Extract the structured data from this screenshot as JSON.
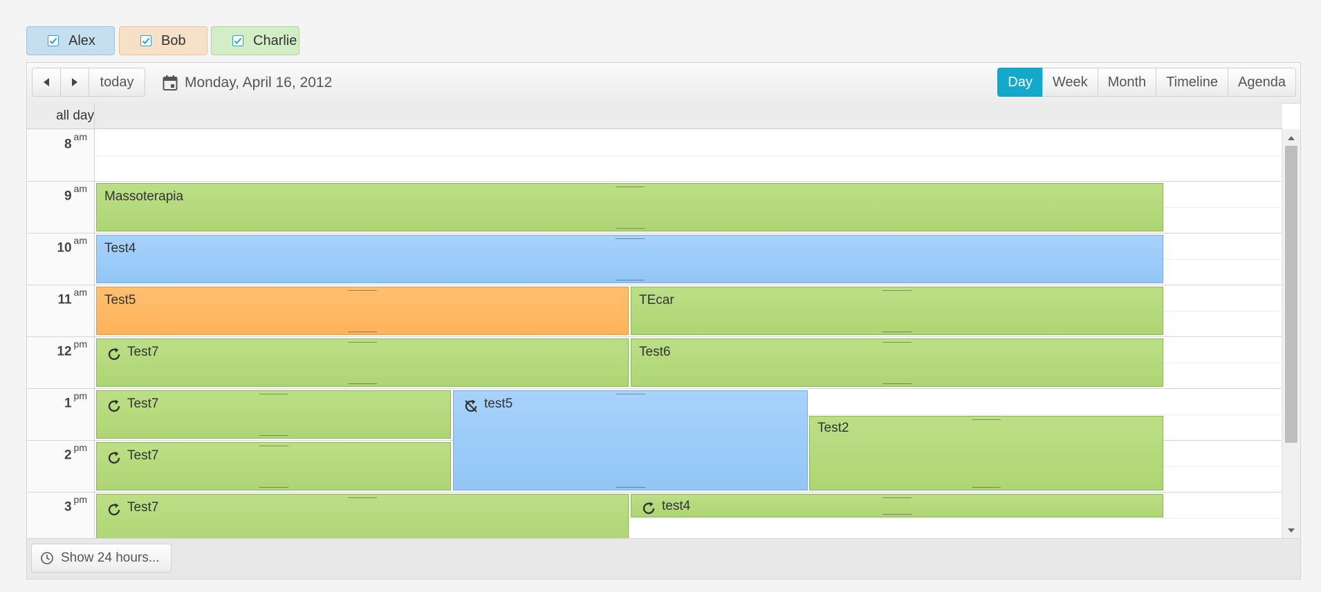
{
  "resources": [
    {
      "label": "Alex",
      "checked": true,
      "color": "#c6dff0"
    },
    {
      "label": "Bob",
      "checked": true,
      "color": "#f7e0c8"
    },
    {
      "label": "Charlie",
      "checked": true,
      "color": "#d3edc6"
    }
  ],
  "toolbar": {
    "today_label": "today",
    "date_label": "Monday, April 16, 2012",
    "views": [
      {
        "label": "Day",
        "active": true
      },
      {
        "label": "Week",
        "active": false
      },
      {
        "label": "Month",
        "active": false
      },
      {
        "label": "Timeline",
        "active": false
      },
      {
        "label": "Agenda",
        "active": false
      }
    ],
    "accent_color": "#14a9cb"
  },
  "allday_label": "all day",
  "hours": [
    {
      "hour": "8",
      "ampm": "am"
    },
    {
      "hour": "9",
      "ampm": "am"
    },
    {
      "hour": "10",
      "ampm": "am"
    },
    {
      "hour": "11",
      "ampm": "am"
    },
    {
      "hour": "12",
      "ampm": "pm"
    },
    {
      "hour": "1",
      "ampm": "pm"
    },
    {
      "hour": "2",
      "ampm": "pm"
    },
    {
      "hour": "3",
      "ampm": "pm"
    }
  ],
  "events": [
    {
      "title": "Massoterapia",
      "color": "green",
      "icon": ""
    },
    {
      "title": "Test4",
      "color": "blue",
      "icon": ""
    },
    {
      "title": "Test5",
      "color": "orange",
      "icon": ""
    },
    {
      "title": "TEcar",
      "color": "green",
      "icon": ""
    },
    {
      "title": "Test7",
      "color": "green",
      "icon": "recurrence-icon"
    },
    {
      "title": "Test6",
      "color": "green",
      "icon": ""
    },
    {
      "title": "Test7",
      "color": "green",
      "icon": "recurrence-icon"
    },
    {
      "title": "test5",
      "color": "blue",
      "icon": "recurrence-exception-icon"
    },
    {
      "title": "Test2",
      "color": "green",
      "icon": ""
    },
    {
      "title": "Test7",
      "color": "green",
      "icon": "recurrence-icon"
    },
    {
      "title": "Test7",
      "color": "green",
      "icon": "recurrence-icon"
    },
    {
      "title": "test4",
      "color": "green",
      "icon": "recurrence-icon"
    }
  ],
  "footer": {
    "show_24_label": "Show 24 hours..."
  }
}
